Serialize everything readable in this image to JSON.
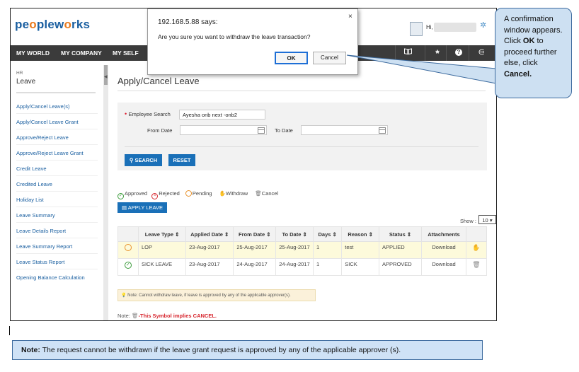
{
  "app": {
    "logo": {
      "p1": "pe",
      "o1": "o",
      "p2": "plew",
      "o2": "o",
      "p3": "rks"
    },
    "user_greeting": "Hi,"
  },
  "nav": {
    "items": [
      "MY WORLD",
      "MY COMPANY",
      "MY SELF"
    ],
    "icons": [
      "book-icon",
      "asterisk-icon",
      "help-icon",
      "sitemap-icon"
    ]
  },
  "sidebar": {
    "section": "HR",
    "title": "Leave",
    "items": [
      "Apply/Cancel Leave(s)",
      "Apply/Cancel Leave Grant",
      "Approve/Reject Leave",
      "Approve/Reject Leave Grant",
      "Credit Leave",
      "Credited Leave",
      "Holiday List",
      "Leave Summary",
      "Leave Details Report",
      "Leave Summary Report",
      "Leave Status Report",
      "Opening Balance Calculation"
    ]
  },
  "page": {
    "title": "Apply/Cancel Leave",
    "search": {
      "employee_label": "Employee Search",
      "employee_value": "Ayesha onb next  -onb2",
      "from_label": "From Date",
      "to_label": "To Date",
      "from_value": "",
      "to_value": "",
      "search_btn": "SEARCH",
      "reset_btn": "RESET"
    },
    "legend": {
      "approved": "Approved",
      "rejected": "Rejected",
      "pending": "Pending",
      "withdraw": "Withdraw",
      "cancel": "Cancel"
    },
    "apply_btn": "APPLY LEAVE",
    "show_label": "Show :",
    "show_value": "10 ▾",
    "table": {
      "headers": [
        "Leave Type ⇕",
        "Applied Date ⇕",
        "From Date ⇕",
        "To Date ⇕",
        "Days ⇕",
        "Reason ⇕",
        "Status ⇕",
        "Attachments"
      ],
      "rows": [
        {
          "status_icon": "pending",
          "leave_type": "LOP",
          "applied": "23-Aug-2017",
          "from": "25-Aug-2017",
          "to": "25-Aug-2017",
          "days": "1",
          "reason": "test",
          "status": "APPLIED",
          "attachment": "Download",
          "action": "withdraw-icon"
        },
        {
          "status_icon": "approved",
          "leave_type": "SICK LEAVE",
          "applied": "23-Aug-2017",
          "from": "24-Aug-2017",
          "to": "24-Aug-2017",
          "days": "1",
          "reason": "SICK",
          "status": "APPROVED",
          "attachment": "Download",
          "action": "cancel-icon"
        }
      ]
    },
    "note": "Note: Cannot withdraw leave, if leave is approved by any of the applicable approver(s).",
    "symbol_note_prefix": "Note:",
    "symbol_note": "-This Symbol implies CANCEL."
  },
  "dialog": {
    "title": "192.168.5.88 says:",
    "message": "Are you sure you want to withdraw the leave transaction?",
    "ok": "OK",
    "cancel": "Cancel",
    "close": "×"
  },
  "callout": {
    "pre": "A confirmation window appears. Click ",
    "ok": "OK",
    "mid": " to proceed further else, click ",
    "cancel": "Cancel."
  },
  "bottom_note": {
    "label": "Note:",
    "text": " The request cannot be withdrawn if the leave grant request is approved by any of the applicable approver (s)."
  },
  "colors": {
    "nav_bg": "#3b3b3b",
    "brand_blue": "#1a70b8",
    "pending_row": "#fdfadb",
    "callout_bg": "#cde0f2",
    "approved_green": "#3a9a3a",
    "rejected_red": "#d7262e",
    "pending_orange": "#e8912a"
  }
}
